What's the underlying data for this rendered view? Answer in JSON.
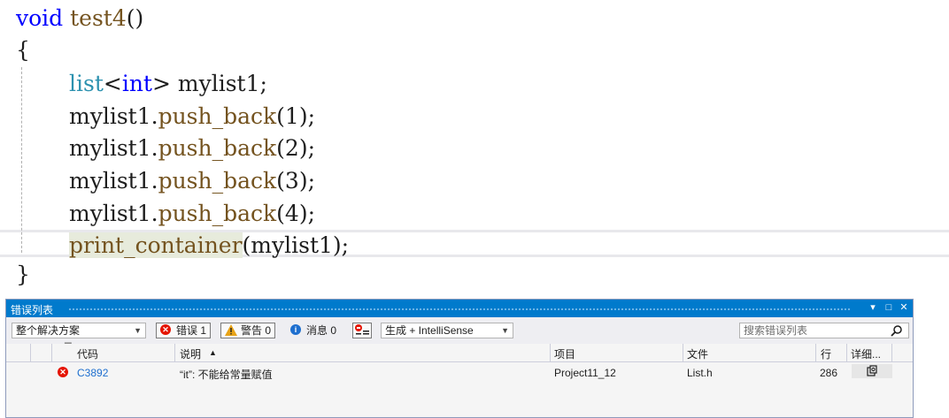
{
  "editor": {
    "line1": {
      "kw": "void",
      "name": "test4",
      "rest": "()"
    },
    "line2": "{",
    "line3": {
      "tmpl": "list",
      "lt": "<",
      "type": "int",
      "gt": ">",
      "rest": " mylist1;"
    },
    "calls": [
      {
        "obj": "mylist1.",
        "fn": "push_back",
        "args": "(1);"
      },
      {
        "obj": "mylist1.",
        "fn": "push_back",
        "args": "(2);"
      },
      {
        "obj": "mylist1.",
        "fn": "push_back",
        "args": "(3);"
      },
      {
        "obj": "mylist1.",
        "fn": "push_back",
        "args": "(4);"
      }
    ],
    "line8": {
      "fn": "print_container",
      "args": "(mylist1);"
    },
    "line9": "}"
  },
  "panel": {
    "title": "错误列表",
    "title_buttons": [
      "▾",
      "□",
      "✕"
    ],
    "toolbar": {
      "scope": "整个解决方案",
      "errors_label": "错误 1",
      "warnings_label": "警告 0",
      "messages_label": "消息 0",
      "build": "生成 + IntelliSense",
      "search_placeholder": "搜索错误列表"
    },
    "columns": {
      "code": "代码",
      "description": "说明",
      "project": "项目",
      "file": "文件",
      "line": "行",
      "details": "详细..."
    },
    "rows": [
      {
        "code": "C3892",
        "description": "“it”: 不能给常量赋值",
        "project": "Project11_12",
        "file": "List.h",
        "line": "286"
      }
    ],
    "colors": {
      "title_bar": "#007acc",
      "error": "#e51400",
      "link": "#1e6fcf"
    }
  }
}
